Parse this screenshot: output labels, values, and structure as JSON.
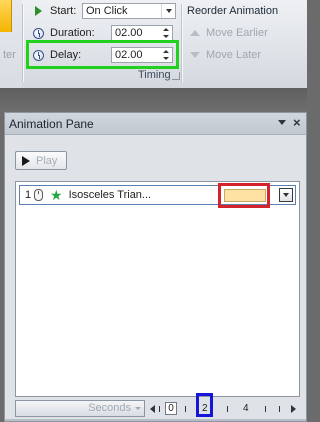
{
  "ribbon": {
    "left_fragment": "ter",
    "timing": {
      "start_label": "Start:",
      "start_value": "On Click",
      "duration_label": "Duration:",
      "duration_value": "02.00",
      "delay_label": "Delay:",
      "delay_value": "02.00",
      "group_label": "Timing"
    },
    "reorder": {
      "title": "Reorder Animation",
      "move_earlier": "Move Earlier",
      "move_later": "Move Later"
    }
  },
  "pane": {
    "title": "Animation Pane",
    "close_glyph": "×",
    "play_label": "Play",
    "items": [
      {
        "number": "1",
        "name": "Isosceles Trian..."
      }
    ],
    "footer": {
      "seconds_label": "Seconds",
      "ticks": [
        "0",
        "2",
        "4"
      ]
    }
  },
  "highlights": {
    "delay": "#22d11d",
    "timing_bar": "#d4242b",
    "timeline_tick": "#1616d8"
  },
  "timing_bar_color": "#fde2a3",
  "icons": [
    "play-icon",
    "clock-icon",
    "mouse-click-icon",
    "star-effect-icon",
    "chevron-down-icon",
    "close-icon",
    "scroll-left-icon",
    "scroll-right-icon"
  ]
}
